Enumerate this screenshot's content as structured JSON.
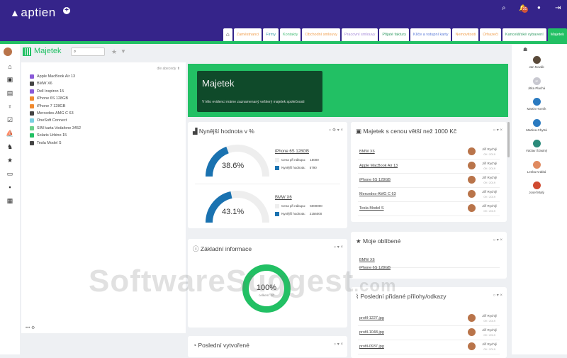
{
  "app": {
    "logo": "aptien",
    "tabs": [
      "Zaměstnanci",
      "Firmy",
      "Kontakty",
      "Obchodní smlouvy",
      "Pracovní smlouvy",
      "Přijaté faktury",
      "Klíče a vstupní karty",
      "Nemovitosti",
      "Úrhazeči",
      "Kancelářské vybavení",
      "Majetek"
    ],
    "tab_colors": [
      "#f0a050",
      "#3a9fa8",
      "#4bbf7a",
      "#f0a050",
      "#a58ad8",
      "#3a9f6a",
      "#5a7ad8",
      "#f0a050",
      "#f0a050",
      "#3a9f6a",
      "#ffffff"
    ],
    "notif_count": "31",
    "accent": "#22c064",
    "topbar": "#35248a"
  },
  "header": {
    "title": "Majetek",
    "search_placeholder": ""
  },
  "list": {
    "sort_label": "dle abecedy",
    "items": [
      {
        "label": "Apple MacBook Air 13",
        "color": "#8a5ad8"
      },
      {
        "label": "BMW X6",
        "color": "#444444"
      },
      {
        "label": "Dell Inspiron 15",
        "color": "#8a5ad8"
      },
      {
        "label": "iPhone 6S 128GB",
        "color": "#f08a30"
      },
      {
        "label": "iPhone 7 128GB",
        "color": "#f08a30"
      },
      {
        "label": "Mercedes-AMG C 63",
        "color": "#444444"
      },
      {
        "label": "OneSoft Connect",
        "color": "#7ad0e0"
      },
      {
        "label": "SIM karta Vodafone 3452",
        "color": "#6ad08a"
      },
      {
        "label": "Solaris Urbino 15",
        "color": "#22c064"
      },
      {
        "label": "Tesla Model S",
        "color": "#444444"
      }
    ]
  },
  "hero": {
    "title": "Majetek",
    "subtitle": "V této evidenci máme zaznamenaný veškerý majetek společnosti"
  },
  "value_card": {
    "title": "Nynější hodnota v %",
    "items": [
      {
        "name": "iPhone 6S 128GB",
        "pct_label": "38.6%",
        "pct": 38.6,
        "buy_label": "Cena při nákupu:",
        "buy": "15000",
        "now_label": "Nynější hodnota:",
        "now": "5790"
      },
      {
        "name": "BMW X6",
        "pct_label": "43.1%",
        "pct": 43.1,
        "buy_label": "Cena při nákupu:",
        "buy": "5000000",
        "now_label": "Nynější hodnota:",
        "now": "2156000"
      }
    ]
  },
  "info_card": {
    "title": "Základní informace",
    "pct": "100%",
    "total": "celkem: 10"
  },
  "recent_card": {
    "title": "Poslední vytvořené"
  },
  "expensive_card": {
    "title": "Majetek s cenou větší než 1000 Kč",
    "rows": [
      {
        "name": "BMW X6",
        "user": "Jiří Rychlý",
        "date": "09 / 2019"
      },
      {
        "name": "Apple MacBook Air 13",
        "user": "Jiří Rychlý",
        "date": "09 / 2019"
      },
      {
        "name": "iPhone 6S 128GB",
        "user": "Jiří Rychlý",
        "date": "09 / 2019"
      },
      {
        "name": "Mercedes-AMG C 63",
        "user": "Jiří Rychlý",
        "date": "09 / 2019"
      },
      {
        "name": "Tesla Model S",
        "user": "Jiří Rychlý",
        "date": "09 / 2019"
      }
    ]
  },
  "fav_card": {
    "title": "Moje oblíbené",
    "items": [
      "BMW X6",
      "iPhone 6S 128GB"
    ]
  },
  "attach_card": {
    "title": "Poslední přidané přílohy/odkazy",
    "rows": [
      {
        "name": "profil-1227.jpg",
        "user": "Jiří Rychlý",
        "date": "09 / 2019"
      },
      {
        "name": "profil-1048.jpg",
        "user": "Jiří Rychlý",
        "date": "09 / 2019"
      },
      {
        "name": "profil-0937.jpg",
        "user": "Jiří Rychlý",
        "date": "09 / 2019"
      }
    ]
  },
  "people": [
    {
      "name": "Jan Novák",
      "color": "#5a4a3a"
    },
    {
      "name": "Jitka Plachá",
      "color": "#c8c8d0",
      "initials": "JP"
    },
    {
      "name": "Martin Horník",
      "color": "#2a7ac0"
    },
    {
      "name": "Martina Chytrá",
      "color": "#2a7ac0"
    },
    {
      "name": "Václav Šťastný",
      "color": "#2a8a7a"
    },
    {
      "name": "Lenka Krátká",
      "color": "#e08a60"
    },
    {
      "name": "Josef Malý",
      "color": "#d04a30"
    }
  ],
  "watermark": "SoftwareSuggest.com"
}
